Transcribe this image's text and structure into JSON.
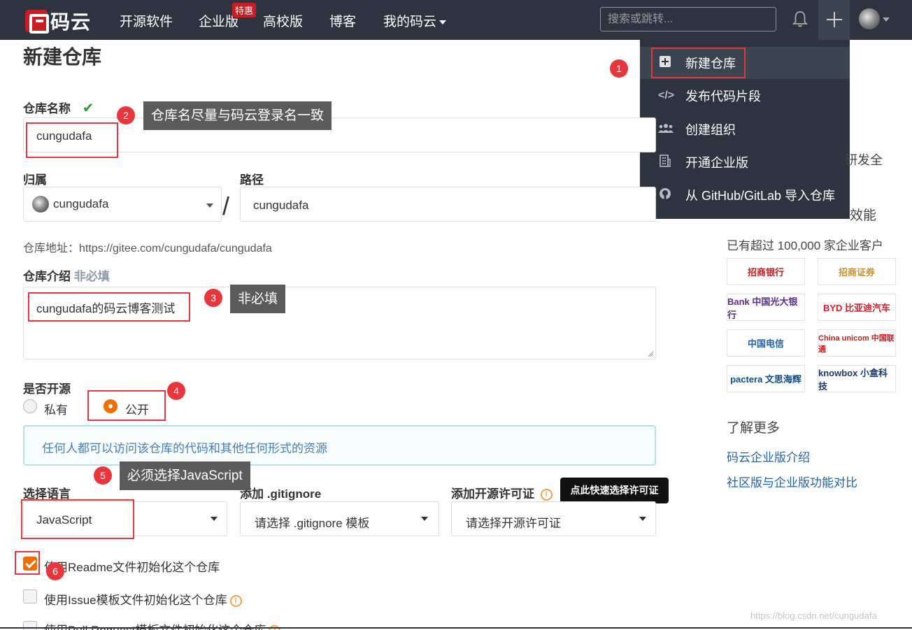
{
  "nav": {
    "brand": "码云",
    "links": [
      "开源软件",
      "企业版",
      "高校版",
      "博客",
      "我的码云"
    ],
    "badge": "特惠",
    "search_placeholder": "搜索或跳转..."
  },
  "dropdown": {
    "items": [
      {
        "label": "新建仓库",
        "icon": "plus-square-icon"
      },
      {
        "label": "发布代码片段",
        "icon": "code-icon"
      },
      {
        "label": "创建组织",
        "icon": "group-icon"
      },
      {
        "label": "开通企业版",
        "icon": "building-icon"
      },
      {
        "label": "从 GitHub/GitLab 导入仓库",
        "icon": "github-icon"
      }
    ]
  },
  "form": {
    "title": "新建仓库",
    "name_label": "仓库名称",
    "name_value": "cungudafa",
    "owner_label": "归属",
    "owner_value": "cungudafa",
    "path_label": "路径",
    "path_value": "cungudafa",
    "address": "仓库地址：https://gitee.com/cungudafa/cungudafa",
    "desc_label": "仓库介绍",
    "desc_optional": "非必填",
    "desc_value": "cungudafa的码云博客测试",
    "open_label": "是否开源",
    "private_label": "私有",
    "public_label": "公开",
    "public_info": "任何人都可以访问该仓库的代码和其他任何形式的资源",
    "lang_label": "选择语言",
    "lang_value": "JavaScript",
    "gitignore_label": "添加 .gitignore",
    "gitignore_value": "请选择 .gitignore 模板",
    "license_label": "添加开源许可证",
    "license_value": "请选择开源许可证",
    "license_tooltip": "点此快速选择许可证",
    "checkboxes": [
      {
        "label": "使用Readme文件初始化这个仓库",
        "checked": true
      },
      {
        "label": "使用Issue模板文件初始化这个仓库",
        "checked": false
      },
      {
        "label": "使用Pull Request模板文件初始化这个仓库",
        "checked": false
      }
    ]
  },
  "annotations": {
    "numbers": [
      "1",
      "2",
      "3",
      "4",
      "5",
      "6"
    ],
    "tip2": "仓库名尽量与码云登录名一致",
    "tip3": "非必填",
    "tip5": "必须选择JavaScript"
  },
  "sidebar": {
    "partial1": "研发全",
    "partial2": "效能",
    "customers": "已有超过 100,000 家企业客户",
    "logos": [
      "招商银行",
      "招商证券",
      "Bank 中国光大银行",
      "BYD 比亚迪汽车",
      "中国电信",
      "China unicom 中国联通",
      "pactera 文思海辉",
      "knowbox 小盒科技"
    ],
    "learn_more": "了解更多",
    "links": [
      "码云企业版介绍",
      "社区版与企业版功能对比"
    ]
  },
  "watermark": "https://blog.csdn.net/cungudafa",
  "colors": {
    "nav_bg": "#2d333f",
    "accent_orange": "#f06d00",
    "annotation_red": "#e0383e",
    "brand_red": "#c71d23"
  }
}
